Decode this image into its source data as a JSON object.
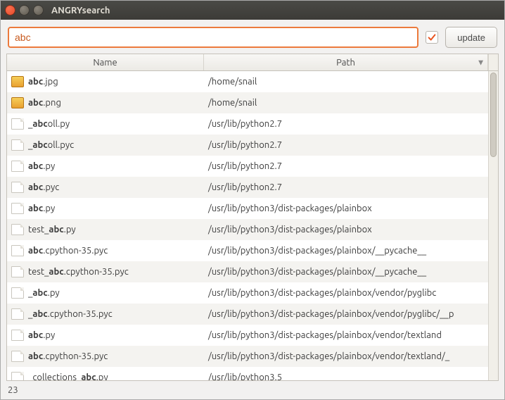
{
  "window": {
    "title": "ANGRYsearch"
  },
  "toolbar": {
    "search_value": "abc",
    "checkbox_checked": true,
    "update_label": "update"
  },
  "columns": {
    "name": "Name",
    "path": "Path"
  },
  "query": "abc",
  "rows": [
    {
      "icon": "img",
      "prefix": "",
      "match": "abc",
      "suffix": ".jpg",
      "path": "/home/snail"
    },
    {
      "icon": "img",
      "prefix": "",
      "match": "abc",
      "suffix": ".png",
      "path": "/home/snail"
    },
    {
      "icon": "doc",
      "prefix": "_",
      "match": "abc",
      "suffix": "oll.py",
      "path": "/usr/lib/python2.7"
    },
    {
      "icon": "doc",
      "prefix": "_",
      "match": "abc",
      "suffix": "oll.pyc",
      "path": "/usr/lib/python2.7"
    },
    {
      "icon": "doc",
      "prefix": "",
      "match": "abc",
      "suffix": ".py",
      "path": "/usr/lib/python2.7"
    },
    {
      "icon": "doc",
      "prefix": "",
      "match": "abc",
      "suffix": ".pyc",
      "path": "/usr/lib/python2.7"
    },
    {
      "icon": "doc",
      "prefix": "",
      "match": "abc",
      "suffix": ".py",
      "path": "/usr/lib/python3/dist-packages/plainbox"
    },
    {
      "icon": "doc",
      "prefix": "test_",
      "match": "abc",
      "suffix": ".py",
      "path": "/usr/lib/python3/dist-packages/plainbox"
    },
    {
      "icon": "doc",
      "prefix": "",
      "match": "abc",
      "suffix": ".cpython-35.pyc",
      "path": "/usr/lib/python3/dist-packages/plainbox/__pycache__"
    },
    {
      "icon": "doc",
      "prefix": "test_",
      "match": "abc",
      "suffix": ".cpython-35.pyc",
      "path": "/usr/lib/python3/dist-packages/plainbox/__pycache__"
    },
    {
      "icon": "doc",
      "prefix": "_",
      "match": "abc",
      "suffix": ".py",
      "path": "/usr/lib/python3/dist-packages/plainbox/vendor/pyglibc"
    },
    {
      "icon": "doc",
      "prefix": "_",
      "match": "abc",
      "suffix": ".cpython-35.pyc",
      "path": "/usr/lib/python3/dist-packages/plainbox/vendor/pyglibc/__p"
    },
    {
      "icon": "doc",
      "prefix": "",
      "match": "abc",
      "suffix": ".py",
      "path": "/usr/lib/python3/dist-packages/plainbox/vendor/textland"
    },
    {
      "icon": "doc",
      "prefix": "",
      "match": "abc",
      "suffix": ".cpython-35.pyc",
      "path": "/usr/lib/python3/dist-packages/plainbox/vendor/textland/_"
    },
    {
      "icon": "doc",
      "prefix": "_collections_",
      "match": "abc",
      "suffix": ".py",
      "path": "/usr/lib/python3.5"
    }
  ],
  "status": {
    "count": "23"
  }
}
